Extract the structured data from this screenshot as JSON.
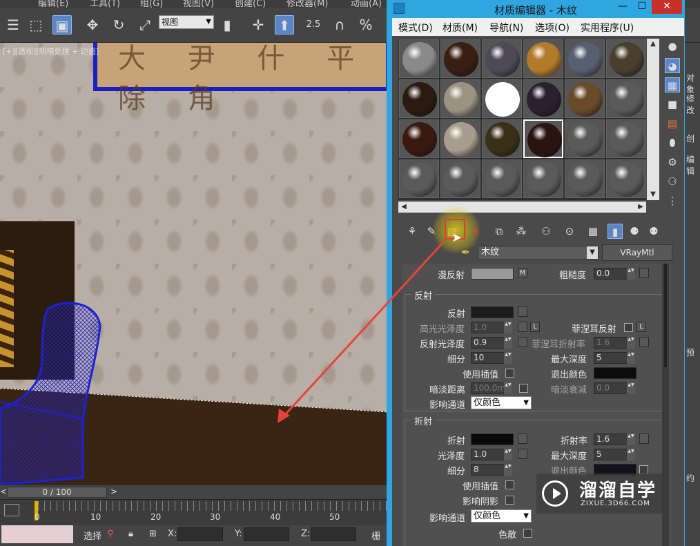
{
  "max": {
    "menus": [
      "编辑(E)",
      "工具(T)",
      "组(G)",
      "视图(V)",
      "创建(C)",
      "修改器(M)",
      "动画(A)"
    ],
    "toolbar": {
      "view_select": "视图",
      "snap_25": "2.5",
      "snap_pct": "%"
    },
    "viewport": {
      "label": "[+][透视][明暗处理 + 边面]",
      "painting_text": "大 尹 什 平 除 角"
    },
    "timeline": {
      "frame": "0 / 100",
      "prev": "<",
      "next": ">"
    },
    "ruler_ticks": [
      "0",
      "10",
      "20",
      "30",
      "40",
      "50"
    ],
    "status": {
      "select_label": "选择",
      "x_label": "X:",
      "y_label": "Y:",
      "z_label": "Z:",
      "grid_label": "栅"
    },
    "right_panel": [
      "对象",
      "修改",
      "创",
      "编辑",
      "预",
      "约"
    ]
  },
  "editor": {
    "title": "材质编辑器 - 木纹",
    "menu": [
      "模式(D)",
      "材质(M)",
      "导航(N)",
      "选项(O)",
      "实用程序(U)"
    ],
    "slots": [
      {
        "color": "#8a8a8a"
      },
      {
        "color": "#3a1e12"
      },
      {
        "color": "#4d4a55"
      },
      {
        "color": "#b27a2a"
      },
      {
        "color": "#566070"
      },
      {
        "color": "#4a3f2f"
      },
      {
        "color": "#2a1a12"
      },
      {
        "color": "#9c9282"
      },
      {
        "color": "#ffffff"
      },
      {
        "color": "#2a2030"
      },
      {
        "color": "#6a4a2a"
      },
      {
        "color": "#5a5a5a"
      },
      {
        "color": "#3a1a10"
      },
      {
        "color": "#a89c8c"
      },
      {
        "color": "#3a3018"
      },
      {
        "color": "#2a1410"
      },
      {
        "color": "#5a5a5a"
      },
      {
        "color": "#5a5a5a"
      },
      {
        "color": "#5a5a5a"
      },
      {
        "color": "#5a5a5a"
      },
      {
        "color": "#5a5a5a"
      },
      {
        "color": "#5a5a5a"
      },
      {
        "color": "#5a5a5a"
      },
      {
        "color": "#5a5a5a"
      }
    ],
    "selected_slot": 15,
    "material_name": "木纹",
    "material_type": "VRayMtl",
    "diffuse": {
      "label": "漫反射",
      "map_btn": "M",
      "rough_label": "粗糙度",
      "rough_value": "0.0"
    },
    "reflection": {
      "section": "反射",
      "refl_label": "反射",
      "hilight_label": "高光光泽度",
      "hilight_value": "1.0",
      "l_btn": "L",
      "fresnel_label": "菲涅耳反射",
      "fresnel_l": "L",
      "gloss_label": "反射光泽度",
      "gloss_value": "0.9",
      "fresnel_ior_label": "菲涅耳折射率",
      "fresnel_ior_value": "1.6",
      "subdiv_label": "细分",
      "subdiv_value": "10",
      "maxdepth_label": "最大深度",
      "maxdepth_value": "5",
      "interp_label": "使用插值",
      "exitcolor_label": "退出颜色",
      "dim_dist_label": "暗淡距离",
      "dim_dist_value": "100.0m",
      "dim_falloff_label": "暗淡衰减",
      "dim_falloff_value": "0.0",
      "affect_label": "影响通道",
      "affect_value": "仅颜色"
    },
    "refraction": {
      "section": "折射",
      "refr_label": "折射",
      "ior_label": "折射率",
      "ior_value": "1.6",
      "gloss_label": "光泽度",
      "gloss_value": "1.0",
      "maxdepth_label": "最大深度",
      "maxdepth_value": "5",
      "subdiv_label": "细分",
      "subdiv_value": "8",
      "exitcolor_label": "退出颜色",
      "interp_label": "使用插值",
      "shadow_label": "影响阴影",
      "affect_label": "影响通道",
      "affect_value": "仅颜色",
      "dispersion_label": "色散"
    }
  },
  "watermark": {
    "name": "溜溜自学",
    "url": "ZIXUE.3D66.COM"
  },
  "colors": {
    "title_bar": "#2fa6e0",
    "highlight": "#e33b2c",
    "arrow": "#e8433a"
  }
}
